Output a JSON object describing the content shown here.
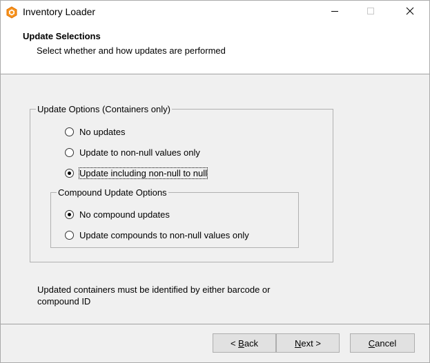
{
  "window": {
    "title": "Inventory Loader",
    "icon": "hexagon-app-icon",
    "controls": [
      "minimize-icon",
      "maximize-icon",
      "close-icon"
    ]
  },
  "header": {
    "title": "Update Selections",
    "subtitle": "Select whether and how updates are performed"
  },
  "update_options": {
    "legend": "Update Options (Containers only)",
    "options": [
      {
        "label": "No updates",
        "checked": false
      },
      {
        "label": "Update to non-null values only",
        "checked": false
      },
      {
        "label": "Update including non-null to null",
        "checked": true
      }
    ]
  },
  "compound_options": {
    "legend": "Compound Update Options",
    "options": [
      {
        "label": "No compound updates",
        "checked": true
      },
      {
        "label": "Update compounds to non-null values only",
        "checked": false
      }
    ]
  },
  "note": "Updated containers must be identified by either barcode or compound ID",
  "buttons": {
    "back": {
      "prefix": "< ",
      "mnemonic": "B",
      "rest": "ack"
    },
    "next": {
      "mnemonic": "N",
      "rest": "ext >"
    },
    "cancel": {
      "mnemonic": "C",
      "rest": "ancel"
    }
  }
}
